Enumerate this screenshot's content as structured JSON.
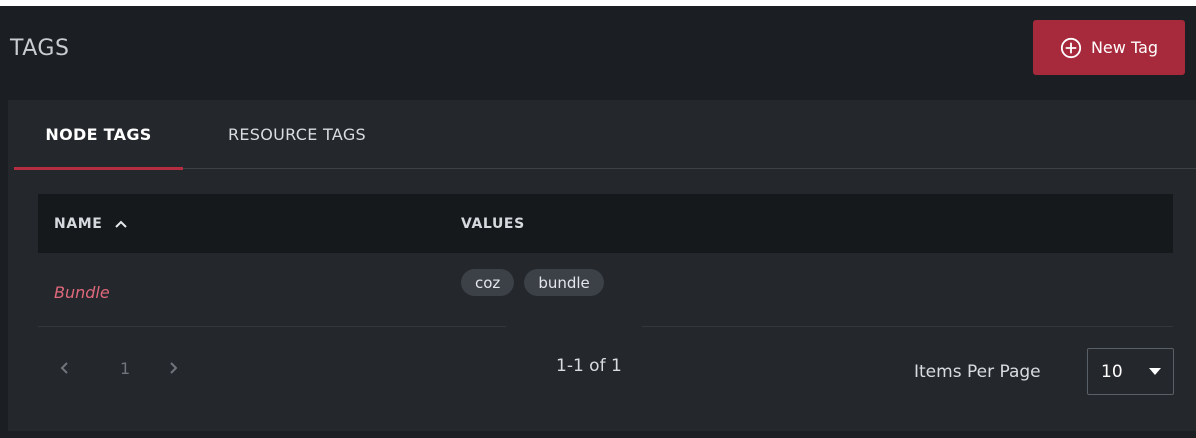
{
  "header": {
    "title": "TAGS",
    "new_tag_label": "New Tag"
  },
  "tabs": [
    {
      "label": "NODE TAGS",
      "active": true
    },
    {
      "label": "RESOURCE TAGS",
      "active": false
    }
  ],
  "table": {
    "columns": [
      {
        "label": "NAME",
        "sort": "ascending"
      },
      {
        "label": "VALUES"
      }
    ],
    "rows": [
      {
        "name": "Bundle",
        "values": [
          "coz",
          "bundle"
        ]
      }
    ]
  },
  "pagination": {
    "current_page": "1",
    "range_text": "1-1 of 1",
    "items_per_page_label": "Items Per Page",
    "items_per_page_value": "10"
  },
  "icons": {
    "new_tag": "plus-circle-icon",
    "sort": "chevron-up-icon",
    "prev": "chevron-left-icon",
    "next": "chevron-right-icon",
    "select": "caret-down-icon"
  },
  "colors": {
    "accent": "#a72a3c",
    "tab_indicator": "#b52d40",
    "link": "#e0697c",
    "background": "#1b1e22",
    "panel": "#24272c"
  }
}
